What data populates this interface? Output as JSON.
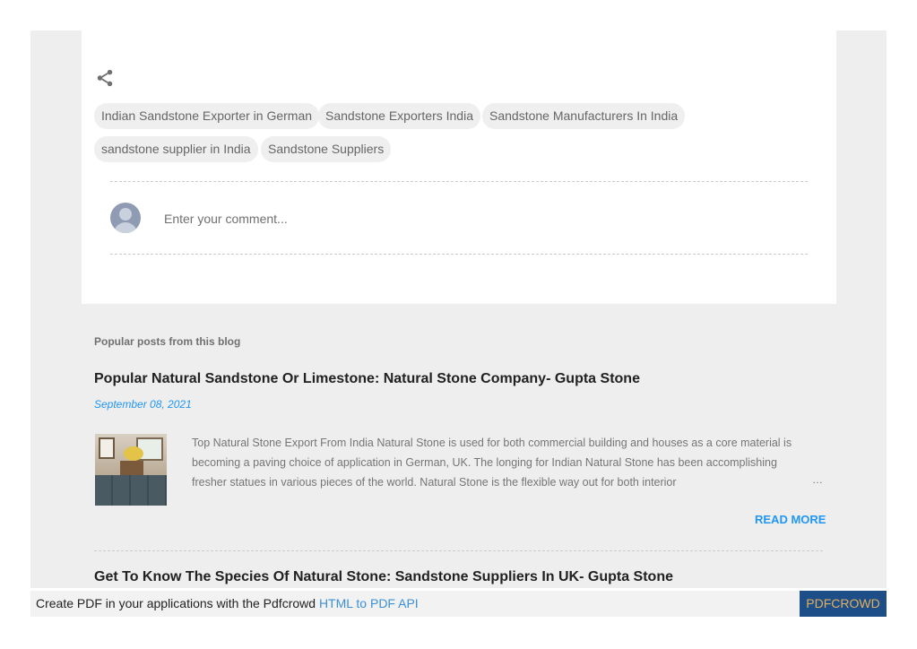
{
  "labels": [
    "Indian Sandstone Exporter in German",
    "Sandstone Exporters India",
    "Sandstone Manufacturers In India",
    "sandstone supplier in India",
    "Sandstone Suppliers"
  ],
  "comment": {
    "placeholder": "Enter your comment..."
  },
  "popular": {
    "heading": "Popular posts from this blog",
    "posts": [
      {
        "title": "Popular Natural Sandstone Or Limestone: Natural Stone Company- Gupta Stone",
        "date": "September 08, 2021",
        "snippet": "Top  Natural Stone Export From India Natural Stone is used for both commercial building and houses as a core material is becoming a paving choice of application in German, UK. The longing for Indian Natural Stone has been accomplishing fresher statues in various pieces of the world. Natural Stone is the flexible way out for both interior",
        "ellipsis": "…",
        "read_more": "READ MORE"
      },
      {
        "title": "Get To Know The Species Of Natural Stone: Sandstone Suppliers In UK- Gupta Stone"
      }
    ]
  },
  "footer": {
    "text": "Create PDF in your applications with the Pdfcrowd ",
    "link": "HTML to PDF API",
    "button": "PDFCROWD"
  },
  "colors": {
    "accent": "#2196f3",
    "pdfcrowd_bg": "#1e4e87"
  },
  "icons": {
    "share": "share-icon",
    "avatar": "avatar"
  }
}
